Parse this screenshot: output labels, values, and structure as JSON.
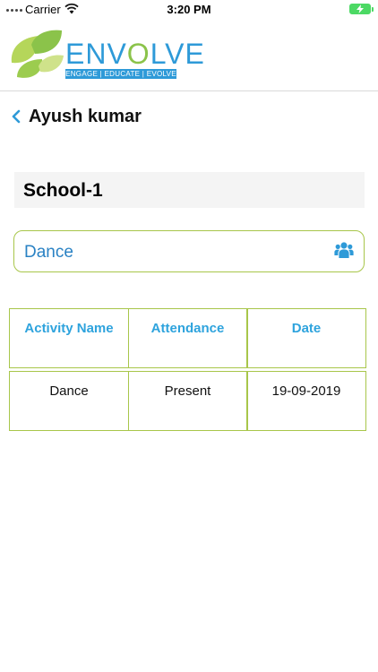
{
  "status_bar": {
    "carrier": "Carrier",
    "time": "3:20 PM",
    "wifi_icon": "wifi-icon",
    "battery_icon": "battery-charging-icon"
  },
  "header": {
    "logo_word_prefix": "ENV",
    "logo_word_o": "O",
    "logo_word_suffix": "LVE",
    "logo_tagline": "ENGAGE | EDUCATE | EVOLVE",
    "logo_icon": "leaves-logo-icon"
  },
  "nav": {
    "back_icon": "chevron-left-icon",
    "title": "Ayush kumar"
  },
  "school": {
    "name": "School-1"
  },
  "activity": {
    "selected": "Dance",
    "icon": "group-icon"
  },
  "table": {
    "columns": [
      "Activity Name",
      "Attendance",
      "Date"
    ],
    "rows": [
      [
        "Dance",
        "Present",
        "19-09-2019"
      ]
    ]
  },
  "colors": {
    "accent_blue": "#2e9ad8",
    "accent_green": "#a8c64a",
    "battery_green": "#4cd964"
  }
}
